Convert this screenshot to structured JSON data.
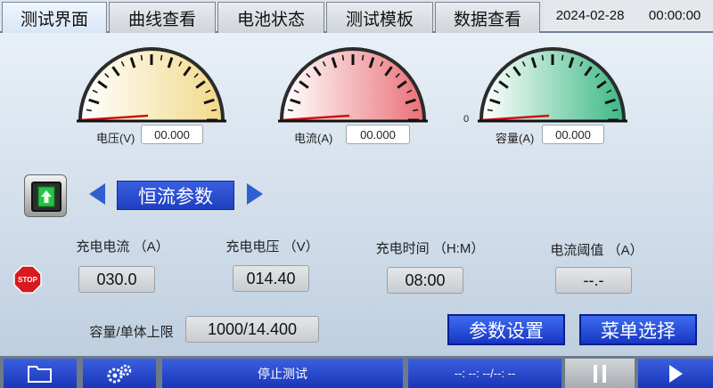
{
  "tabs": [
    {
      "label": "测试界面",
      "active": true
    },
    {
      "label": "曲线查看",
      "active": false
    },
    {
      "label": "电池状态",
      "active": false
    },
    {
      "label": "测试模板",
      "active": false
    },
    {
      "label": "数据查看",
      "active": false
    }
  ],
  "datetime": {
    "date": "2024-02-28",
    "time": "00:00:00"
  },
  "gauges": [
    {
      "label": "电压(V)",
      "value": "00.000",
      "color": "#f5dfa0"
    },
    {
      "label": "电流(A)",
      "value": "00.000",
      "color": "#ee8f92"
    },
    {
      "label": "容量(A)",
      "value": "00.000",
      "color": "#5ec89a",
      "zero_label": "0"
    }
  ],
  "mode": {
    "label": "恒流参数"
  },
  "params": [
    {
      "label": "充电电流 （A）",
      "value": "030.0"
    },
    {
      "label": "充电电压 （V）",
      "value": "014.40"
    },
    {
      "label": "充电时间 （H:M）",
      "value": "08:00"
    },
    {
      "label": "电流阈值 （A）",
      "value": "--.-"
    }
  ],
  "capacity": {
    "label": "容量/单体上限",
    "value": "1000/14.400"
  },
  "stop_icon_text": "STOP",
  "buttons": {
    "param_settings": "参数设置",
    "menu_select": "菜单选择"
  },
  "bottom": {
    "status": "停止测试",
    "time_readout": "--: --: --/--: --"
  }
}
